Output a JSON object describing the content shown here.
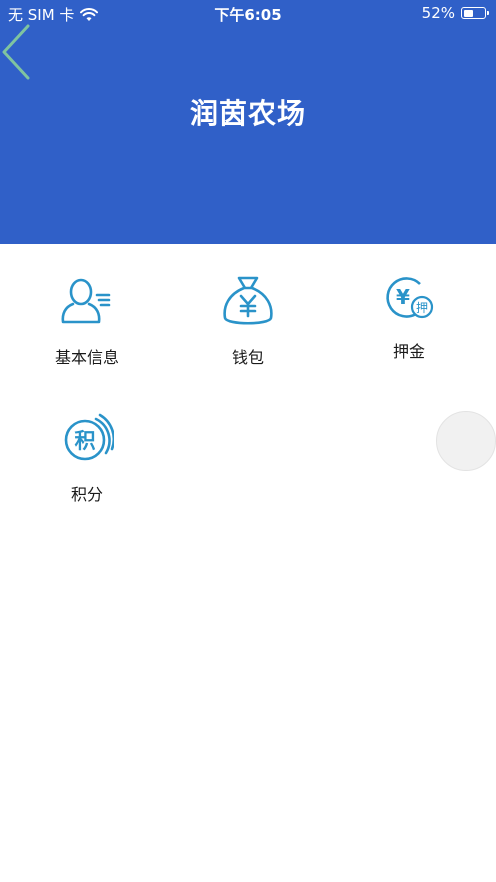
{
  "status_bar": {
    "carrier": "无 SIM 卡",
    "time": "下午6:05",
    "battery": "52%",
    "battery_level": 0.52
  },
  "header": {
    "title": "润茵农场",
    "back_icon": "chevron-left-icon"
  },
  "menu": {
    "items": [
      {
        "label": "基本信息",
        "icon": "user-info-icon"
      },
      {
        "label": "钱包",
        "icon": "money-bag-icon"
      },
      {
        "label": "押金",
        "icon": "deposit-icon",
        "icon_text_main": "¥",
        "icon_text_badge": "押"
      },
      {
        "label": "积分",
        "icon": "points-icon",
        "icon_text": "积"
      }
    ]
  },
  "colors": {
    "header_bg": "#3060c8",
    "icon_blue": "#2a93c9",
    "back_green": "#7fc4a0"
  }
}
